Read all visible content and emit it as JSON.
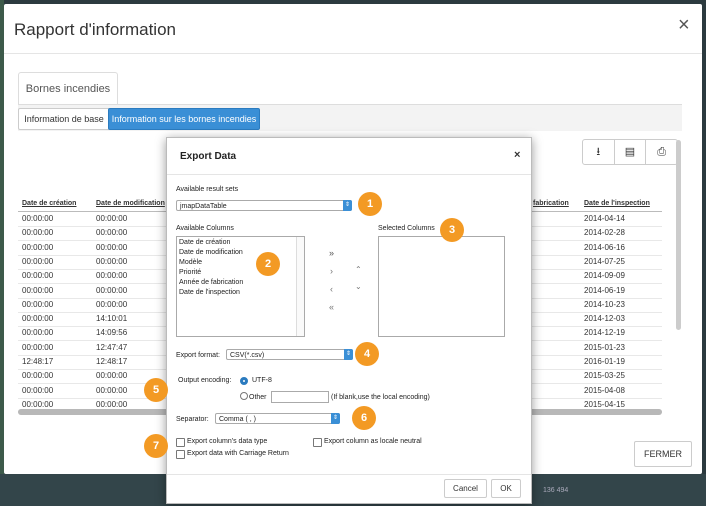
{
  "background": {
    "scale_text": "136 494"
  },
  "modal": {
    "title": "Rapport d'information",
    "close": "×"
  },
  "tabs": {
    "main": "Bornes incendies"
  },
  "subnav": {
    "base": "Information de base",
    "bornes": "Information sur les bornes incendies"
  },
  "toolbar": {
    "export": "⭳",
    "print_preview": "▤",
    "print": "⎙"
  },
  "table": {
    "headers": [
      "Date de création",
      "Date de modification",
      "fabrication",
      "Date de l'inspection"
    ],
    "rows": [
      [
        "00:00:00",
        "00:00:00",
        "2014-04-14"
      ],
      [
        "00:00:00",
        "00:00:00",
        "2014-02-28"
      ],
      [
        "00:00:00",
        "00:00:00",
        "2014-06-16"
      ],
      [
        "00:00:00",
        "00:00:00",
        "2014-07-25"
      ],
      [
        "00:00:00",
        "00:00:00",
        "2014-09-09"
      ],
      [
        "00:00:00",
        "00:00:00",
        "2014-06-19"
      ],
      [
        "00:00:00",
        "00:00:00",
        "2014-10-23"
      ],
      [
        "00:00:00",
        "14:10:01",
        "2014-12-03"
      ],
      [
        "00:00:00",
        "14:09:56",
        "2014-12-19"
      ],
      [
        "00:00:00",
        "12:47:47",
        "2015-01-23"
      ],
      [
        "12:48:17",
        "12:48:17",
        "2016-01-19"
      ],
      [
        "00:00:00",
        "00:00:00",
        "2015-03-25"
      ],
      [
        "00:00:00",
        "00:00:00",
        "2015-04-08"
      ],
      [
        "00:00:00",
        "00:00:00",
        "2015-04-15"
      ]
    ]
  },
  "fermer": "FERMER",
  "dialog": {
    "title": "Export Data",
    "close": "×",
    "result_sets_label": "Available result sets",
    "result_set_value": "jmapDataTable",
    "available_columns_label": "Available Columns",
    "available_columns": [
      "Date de création",
      "Date de modification",
      "Modèle",
      "Priorité",
      "Année de fabrication",
      "Date de l'inspection"
    ],
    "selected_columns_label": "Selected Columns",
    "export_format_label": "Export format:",
    "export_format_value": "CSV(*.csv)",
    "output_encoding_label": "Output encoding:",
    "encoding_utf8": "UTF-8",
    "encoding_other": "Other",
    "encoding_hint": "(If blank,use the local encoding)",
    "separator_label": "Separator:",
    "separator_value": "Comma ( , )",
    "chk_datatype": "Export column's data type",
    "chk_locale": "Export column as locale neutral",
    "chk_carriage": "Export data with Carriage Return",
    "cancel": "Cancel",
    "ok": "OK"
  },
  "badges": [
    "1",
    "2",
    "3",
    "4",
    "5",
    "6",
    "7"
  ],
  "colors": {
    "accent": "#3a8fd6",
    "badge": "#f39a24"
  }
}
